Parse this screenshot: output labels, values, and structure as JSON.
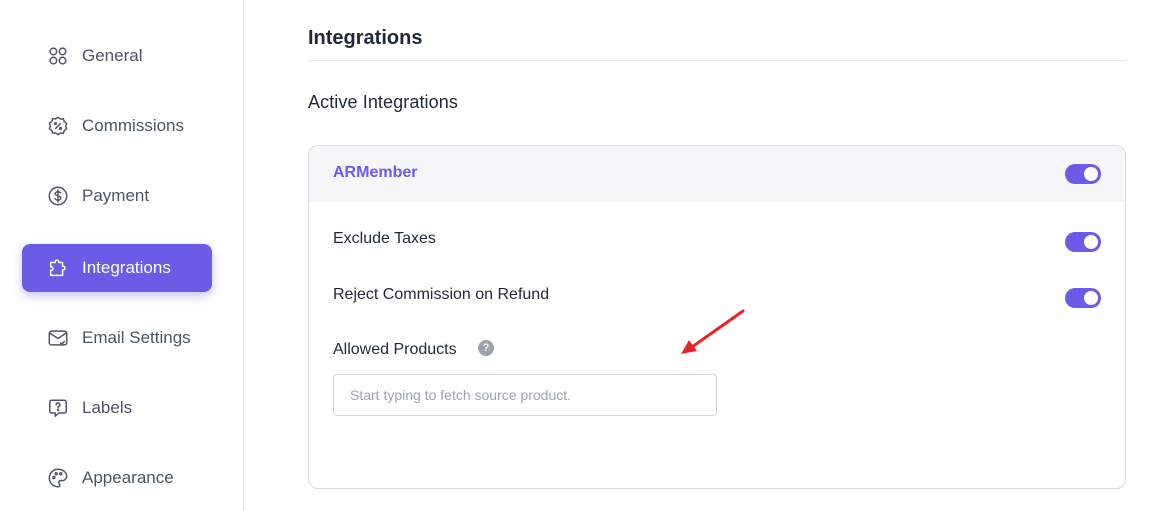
{
  "sidebar": {
    "items": [
      {
        "label": "General",
        "icon": "grid-icon",
        "active": false
      },
      {
        "label": "Commissions",
        "icon": "percent-badge-icon",
        "active": false
      },
      {
        "label": "Payment",
        "icon": "dollar-icon",
        "active": false
      },
      {
        "label": "Integrations",
        "icon": "puzzle-icon",
        "active": true
      },
      {
        "label": "Email Settings",
        "icon": "email-icon",
        "active": false
      },
      {
        "label": "Labels",
        "icon": "question-chat-icon",
        "active": false
      },
      {
        "label": "Appearance",
        "icon": "palette-icon",
        "active": false
      }
    ]
  },
  "main": {
    "title": "Integrations",
    "section_title": "Active Integrations",
    "card": {
      "title": "ARMember",
      "enabled": true,
      "settings": [
        {
          "label": "Exclude Taxes",
          "enabled": true
        },
        {
          "label": "Reject Commission on Refund",
          "enabled": true
        }
      ],
      "allowed_products": {
        "label": "Allowed Products",
        "help": "?",
        "placeholder": "Start typing to fetch source product.",
        "value": ""
      }
    }
  },
  "colors": {
    "accent": "#6b5be6",
    "annotation": "#e8242b"
  }
}
